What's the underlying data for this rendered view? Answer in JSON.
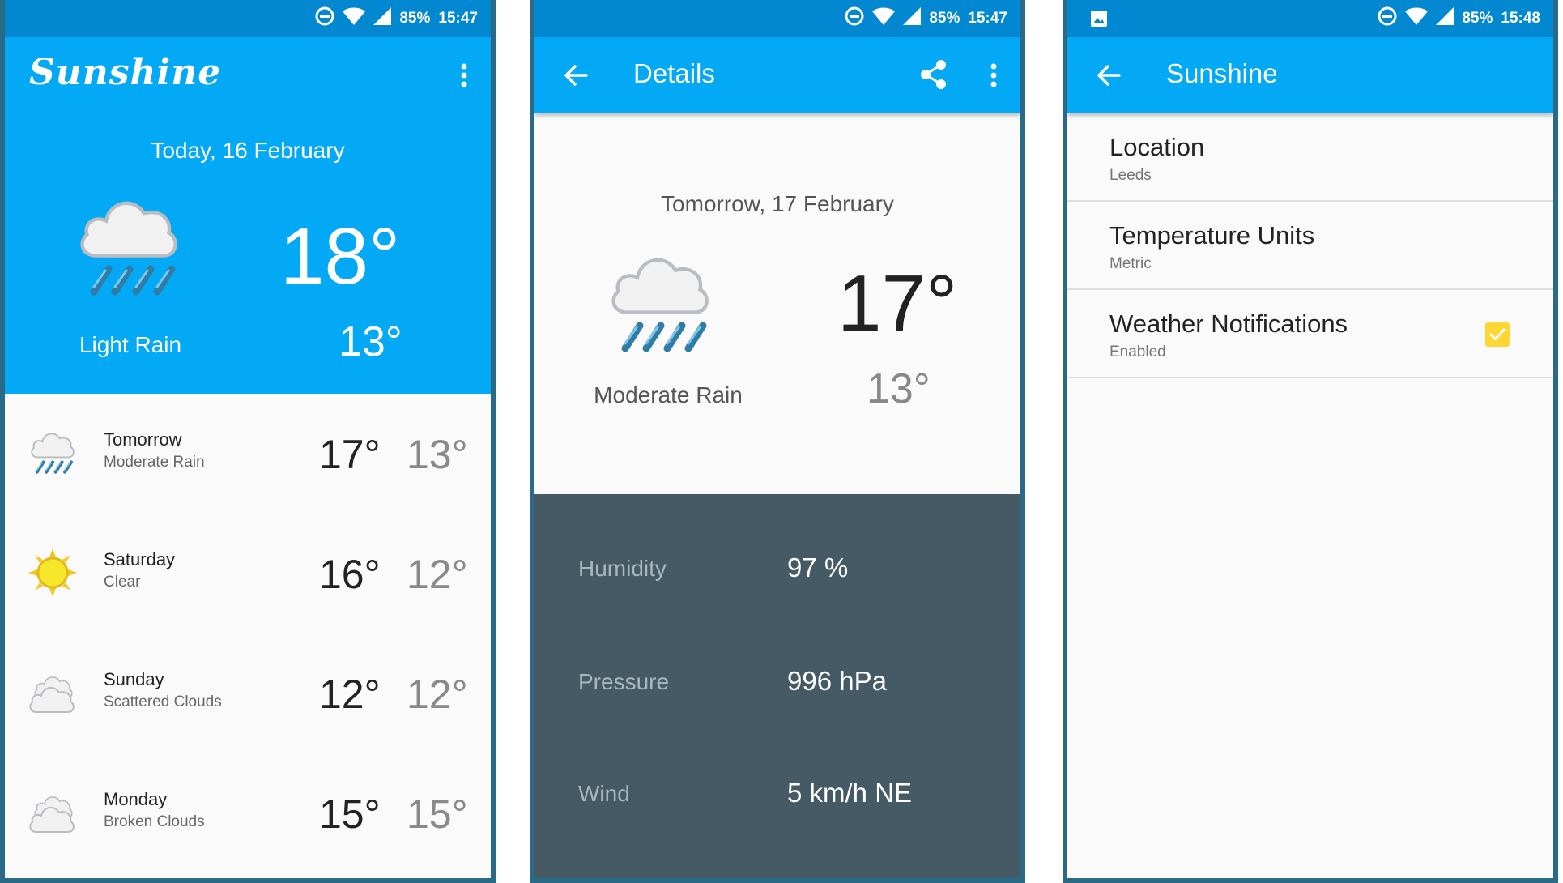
{
  "colors": {
    "primary": "#03a9f4",
    "primary_dark": "#0288d1",
    "detail_panel": "#455a64",
    "checkbox": "#fdd835"
  },
  "status_bar": [
    {
      "battery": "85%",
      "time": "15:47"
    },
    {
      "battery": "85%",
      "time": "15:47"
    },
    {
      "battery": "85%",
      "time": "15:48"
    }
  ],
  "main": {
    "brand": "Sunshine",
    "today": {
      "date": "Today, 16 February",
      "description": "Light Rain",
      "high": "18°",
      "low": "13°",
      "icon": "light-rain-icon"
    },
    "forecast": [
      {
        "day": "Tomorrow",
        "description": "Moderate Rain",
        "high": "17°",
        "low": "13°",
        "icon": "rain-icon"
      },
      {
        "day": "Saturday",
        "description": "Clear",
        "high": "16°",
        "low": "12°",
        "icon": "sun-icon"
      },
      {
        "day": "Sunday",
        "description": "Scattered Clouds",
        "high": "12°",
        "low": "12°",
        "icon": "clouds-icon"
      },
      {
        "day": "Monday",
        "description": "Broken Clouds",
        "high": "15°",
        "low": "15°",
        "icon": "clouds-icon"
      }
    ]
  },
  "details": {
    "title": "Details",
    "date": "Tomorrow, 17 February",
    "description": "Moderate Rain",
    "high": "17°",
    "low": "13°",
    "humidity_label": "Humidity",
    "humidity_value": "97 %",
    "pressure_label": "Pressure",
    "pressure_value": "996 hPa",
    "wind_label": "Wind",
    "wind_value": "5 km/h NE"
  },
  "settings": {
    "title": "Sunshine",
    "prefs": [
      {
        "title": "Location",
        "summary": "Leeds"
      },
      {
        "title": "Temperature Units",
        "summary": "Metric"
      },
      {
        "title": "Weather Notifications",
        "summary": "Enabled",
        "checked": true
      }
    ]
  }
}
